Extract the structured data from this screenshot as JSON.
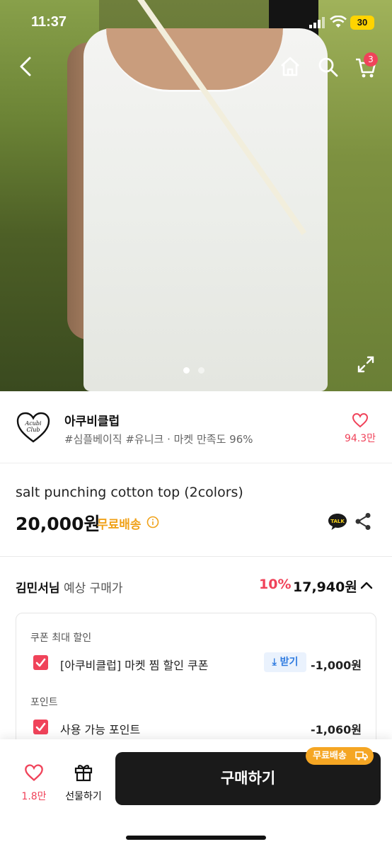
{
  "status_bar": {
    "time": "11:37",
    "battery": "30"
  },
  "header": {
    "cart_count": "3"
  },
  "gallery": {
    "total_images": 2,
    "active_index": 0
  },
  "store": {
    "name": "아쿠비클럽",
    "logo_text": "Acubi Club",
    "tags": "#심플베이직 #유니크 · 마켓 만족도 96%",
    "like_count": "94.3만"
  },
  "product": {
    "name": "salt punching cotton top (2colors)",
    "price": "20,000원",
    "shipping_label": "무료배송",
    "talk_label": "TALK"
  },
  "expected_price": {
    "user_name": "김민서님",
    "label": "예상 구매가",
    "discount_pct": "10%",
    "price": "17,940원"
  },
  "discounts": {
    "coupon_heading": "쿠폰 최대 할인",
    "coupon_label": "[아쿠비클럽] 마켓 찜 할인 쿠폰",
    "coupon_get": "받기",
    "coupon_amount": "-1,000원",
    "point_heading": "포인트",
    "point_label": "사용 가능 포인트",
    "point_amount": "-1,060원"
  },
  "bottom_bar": {
    "like_count": "1.8만",
    "gift_label": "선물하기",
    "buy_label": "구매하기",
    "shipping_chip": "무료배송"
  },
  "colors": {
    "accent": "#f0435a",
    "shipping": "#f0a21a",
    "buy_button": "#1a1a1a"
  }
}
